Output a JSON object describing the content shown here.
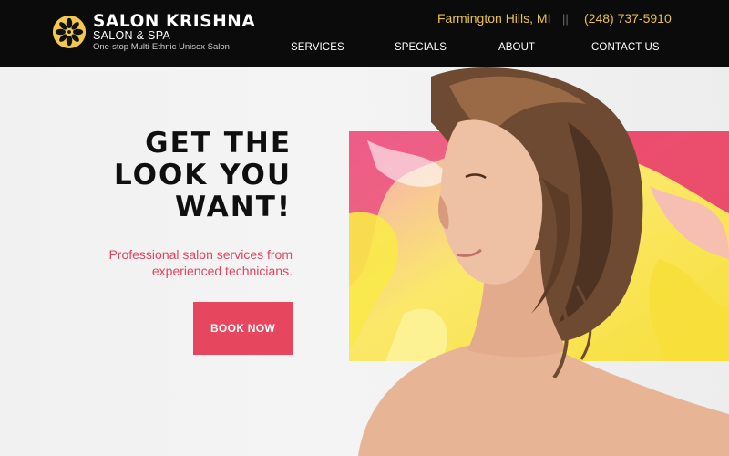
{
  "brand": {
    "name": "SALON KRISHNA",
    "subtitle": "SALON & SPA",
    "tagline": "One-stop Multi-Ethnic Unisex Salon",
    "logo_icon": "flower-icon",
    "logo_color": "#f2c94c"
  },
  "contact": {
    "location": "Farmington Hills, MI",
    "separator": "||",
    "phone": "(248) 737-5910"
  },
  "nav": {
    "items": [
      {
        "label": "SERVICES"
      },
      {
        "label": "SPECIALS"
      },
      {
        "label": "ABOUT"
      },
      {
        "label": "CONTACT US"
      }
    ]
  },
  "hero": {
    "title_lines": [
      "GET THE",
      "LOOK YOU",
      "WANT!"
    ],
    "subtitle": "Professional salon services from experienced technicians.",
    "cta_label": "BOOK NOW",
    "accent_color": "#e7475e",
    "gold_color": "#e9c24a"
  }
}
